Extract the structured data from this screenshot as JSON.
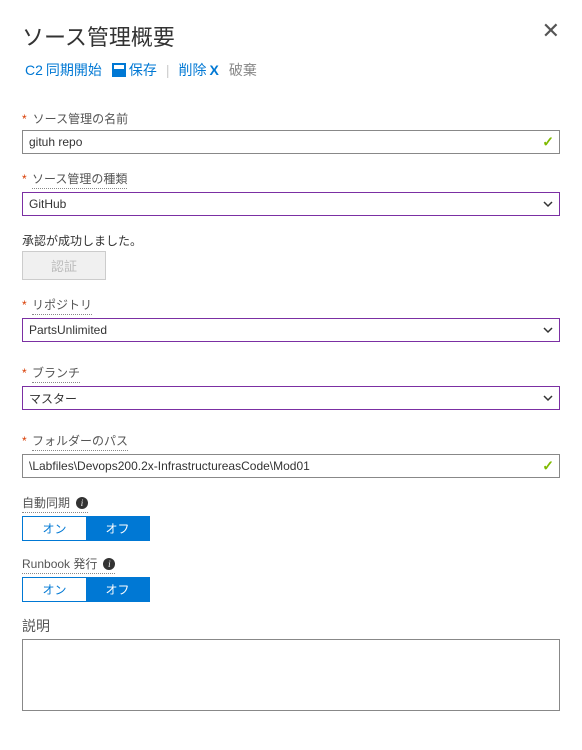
{
  "header": {
    "title": "ソース管理概要"
  },
  "toolbar": {
    "sync": "同期開始",
    "sync_prefix": "C2",
    "save": "保存",
    "delete": "削除",
    "discard": "破棄"
  },
  "fields": {
    "name": {
      "label": "ソース管理の名前",
      "value": "gituh repo"
    },
    "type": {
      "label": "ソース管理の種類",
      "value": "GitHub"
    },
    "auth": {
      "success_msg": "承認が成功しました。",
      "button": "認証"
    },
    "repo": {
      "label": "リポジトリ",
      "value": "PartsUnlimited"
    },
    "branch": {
      "label": "ブランチ",
      "value": "マスター"
    },
    "folder": {
      "label": "フォルダーのパス",
      "value": "\\Labfiles\\Devops200.2x-InfrastructureasCode\\Mod01"
    },
    "autosync": {
      "label": "自動同期",
      "on": "オン",
      "off": "オフ",
      "value": "オフ"
    },
    "publish": {
      "label": "Runbook 発行",
      "on": "オン",
      "off": "オフ",
      "value": "オフ"
    },
    "description": {
      "label": "説明",
      "value": ""
    }
  }
}
